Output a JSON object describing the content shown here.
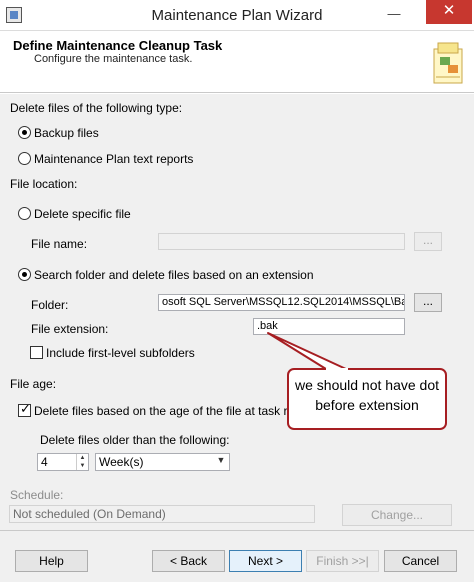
{
  "window": {
    "title": "Maintenance Plan Wizard",
    "minimize": "—",
    "close": "✕"
  },
  "header": {
    "title": "Define Maintenance Cleanup Task",
    "subtitle": "Configure the maintenance task."
  },
  "file_type": {
    "label": "Delete files of the following type:",
    "options": [
      "Backup files",
      "Maintenance Plan text reports"
    ],
    "selected": "Backup files"
  },
  "file_location": {
    "label": "File location:",
    "delete_specific": "Delete specific file",
    "file_name_label": "File name:",
    "file_name_value": "",
    "search_folder": "Search folder and delete files based on an extension",
    "folder_label": "Folder:",
    "folder_value": "osoft SQL Server\\MSSQL12.SQL2014\\MSSQL\\Backup",
    "browse_label": "...",
    "extension_label": "File extension:",
    "extension_value": ".bak",
    "subfolders_label": "Include first-level subfolders"
  },
  "file_age": {
    "label": "File age:",
    "delete_by_age": "Delete files based on the age of the file at task run tim",
    "older_than_label": "Delete files older than the following:",
    "amount": "4",
    "unit": "Week(s)"
  },
  "schedule": {
    "label": "Schedule:",
    "value": "Not scheduled (On Demand)",
    "change_button": "Change..."
  },
  "annotation": {
    "text": "we should not have dot before extension",
    "color": "#a61e22"
  },
  "footer": {
    "help": "Help",
    "back": "< Back",
    "next": "Next >",
    "finish": "Finish >>|",
    "cancel": "Cancel"
  }
}
